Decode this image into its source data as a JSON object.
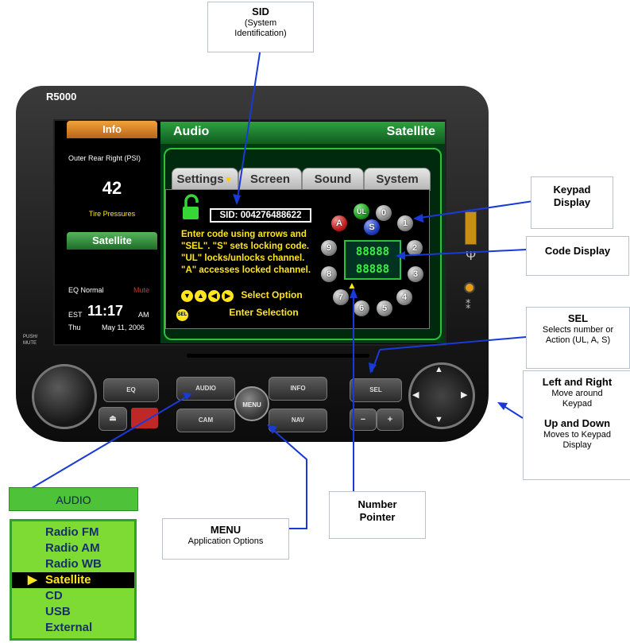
{
  "device": {
    "model": "R5000",
    "push_mute": "PUSH/\nMUTE"
  },
  "left_panel": {
    "info_title": "Info",
    "sensor_label": "Outer Rear Right (PSI)",
    "value": "42",
    "caption": "Tire Pressures",
    "source_title": "Satellite",
    "eq_label": "EQ  Normal",
    "mute_label": "Mute",
    "tz": "EST",
    "time": "11:17",
    "ampm": "AM",
    "day": "Thu",
    "date": "May 11, 2006"
  },
  "main_panel": {
    "title": "Audio",
    "source": "Satellite",
    "tabs": [
      {
        "label": "Settings"
      },
      {
        "label": "Screen"
      },
      {
        "label": "Sound"
      },
      {
        "label": "System"
      }
    ],
    "sid": "SID: 004276488622",
    "instructions": [
      "Enter code using arrows and",
      "\"SEL\". \"S\" sets locking code.",
      "\"UL\" locks/unlocks channel.",
      "\"A\" accesses locked channel."
    ],
    "select_option": "Select Option",
    "enter_selection": "Enter Selection",
    "sel_icon_text": "SEL",
    "keypad": [
      "UL",
      "0",
      "1",
      "2",
      "3",
      "4",
      "5",
      "6",
      "7",
      "8",
      "9",
      "A",
      "S"
    ],
    "code_display": "88888 88888"
  },
  "buttons": {
    "eq": "EQ",
    "audio": "AUDIO",
    "menu": "MENU",
    "info": "INFO",
    "cam": "CAM",
    "nav": "NAV",
    "sel": "SEL",
    "minus": "−",
    "plus": "+"
  },
  "callouts": {
    "sid_title": "SID",
    "sid_desc": "(System Identification)",
    "keypad_title": "Keypad Display",
    "code_title": "Code Display",
    "sel_title": "SEL",
    "sel_desc": "Selects number or Action (UL, A, S)",
    "lr_title": "Left and Right",
    "lr_desc": "Move around Keypad",
    "ud_title": "Up and Down",
    "ud_desc": "Moves to Keypad Display",
    "number_title": "Number Pointer",
    "menu_title": "MENU",
    "menu_desc": "Application Options"
  },
  "audio_menu": {
    "title": "AUDIO",
    "items": [
      "Radio FM",
      "Radio AM",
      "Radio WB",
      "Satellite",
      "CD",
      "USB",
      "External"
    ],
    "selected": "Satellite"
  },
  "colors": {
    "screen_green": "#2ec03c",
    "instruction_yellow": "#ffe61a",
    "info_orange": "#e58b25",
    "menu_green": "#7ddb33"
  }
}
